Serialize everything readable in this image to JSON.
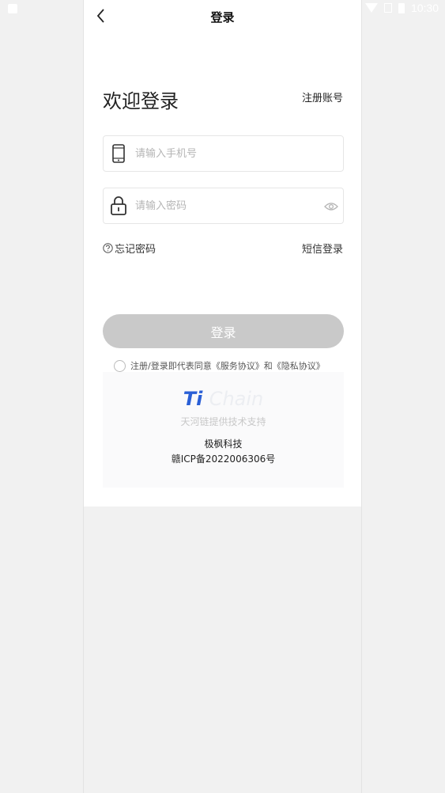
{
  "status_bar": {
    "time": "10:30"
  },
  "nav": {
    "title": "登录"
  },
  "welcome": {
    "title": "欢迎登录",
    "register_link": "注册账号"
  },
  "phone_field": {
    "placeholder": "请输入手机号",
    "value": ""
  },
  "password_field": {
    "placeholder": "请输入密码",
    "value": ""
  },
  "links": {
    "forgot_password": "忘记密码",
    "sms_login": "短信登录"
  },
  "login_button": {
    "label": "登录"
  },
  "agreement": {
    "text": "注册/登录即代表同意《服务协议》和《隐私协议》"
  },
  "footer": {
    "logo_ti": "Ti",
    "logo_chain": "Chain",
    "support_text": "天河链提供技术支持",
    "company": "极枫科技",
    "icp": "赣ICP备2022006306号"
  },
  "colors": {
    "button_disabled": "#c9c9c9",
    "logo_blue": "#2a5fd6"
  }
}
